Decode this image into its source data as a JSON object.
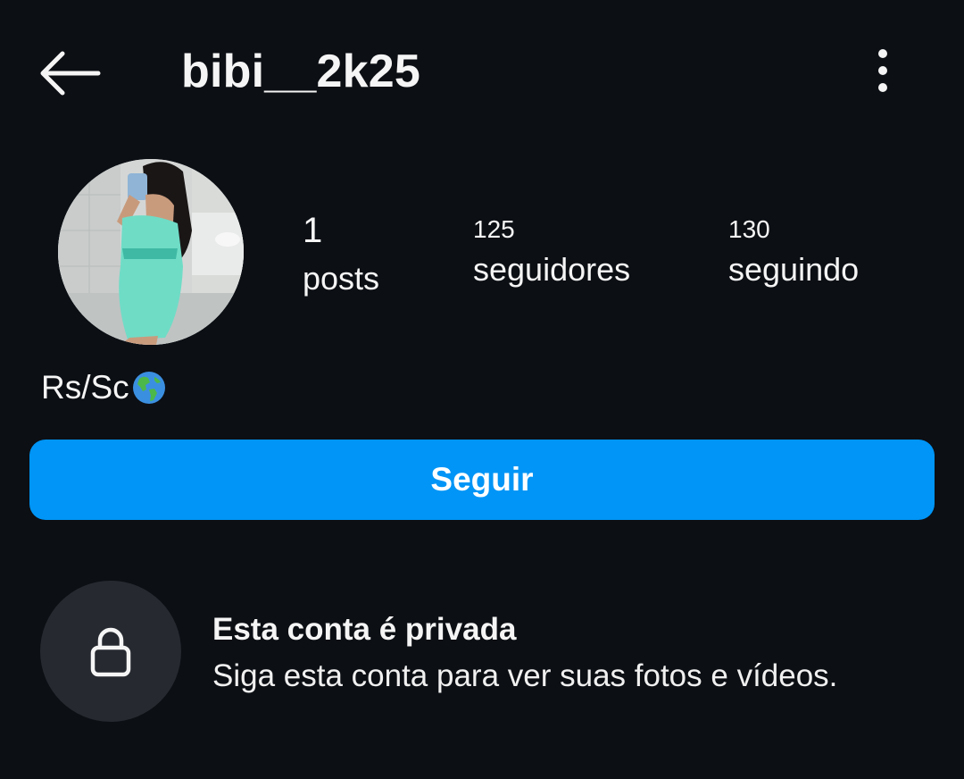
{
  "header": {
    "username": "bibi__2k25",
    "back_icon": "arrow-left-icon",
    "more_icon": "more-vertical-icon"
  },
  "profile": {
    "avatar": "profile-photo",
    "stats": {
      "posts": {
        "count": "1",
        "label": "posts"
      },
      "followers": {
        "count": "125",
        "label": "seguidores"
      },
      "following": {
        "count": "130",
        "label": "seguindo"
      }
    },
    "bio": {
      "text": "Rs/Sc",
      "emoji_icon": "globe-americas-icon"
    }
  },
  "actions": {
    "follow_label": "Seguir"
  },
  "private_notice": {
    "icon": "lock-icon",
    "title": "Esta conta é privada",
    "subtitle": "Siga esta conta para ver suas fotos e vídeos."
  },
  "colors": {
    "background": "#0c0f14",
    "primary": "#0095f6",
    "lock_circle": "#262a30",
    "text": "#f5f5f5"
  }
}
